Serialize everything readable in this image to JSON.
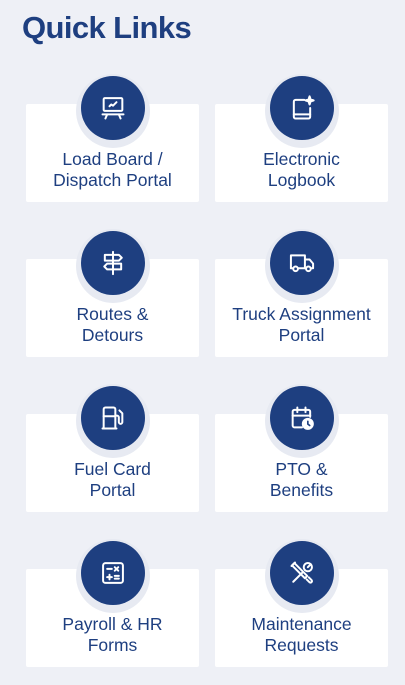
{
  "title": "Quick Links",
  "links": [
    {
      "icon": "presentation-board-icon",
      "line1": "Load Board /",
      "line2": "Dispatch Portal"
    },
    {
      "icon": "logbook-sparkle-icon",
      "line1": "Electronic",
      "line2": "Logbook"
    },
    {
      "icon": "signpost-icon",
      "line1": "Routes &",
      "line2": "Detours"
    },
    {
      "icon": "truck-icon",
      "line1": "Truck Assignment",
      "line2": "Portal"
    },
    {
      "icon": "fuel-pump-icon",
      "line1": "Fuel Card",
      "line2": "Portal"
    },
    {
      "icon": "calendar-clock-icon",
      "line1": "PTO &",
      "line2": "Benefits"
    },
    {
      "icon": "calculator-icon",
      "line1": "Payroll & HR",
      "line2": "Forms"
    },
    {
      "icon": "tools-icon",
      "line1": "Maintenance",
      "line2": "Requests"
    }
  ],
  "colors": {
    "accent": "#1e3f80",
    "background": "#eef0f6",
    "card": "#ffffff"
  }
}
